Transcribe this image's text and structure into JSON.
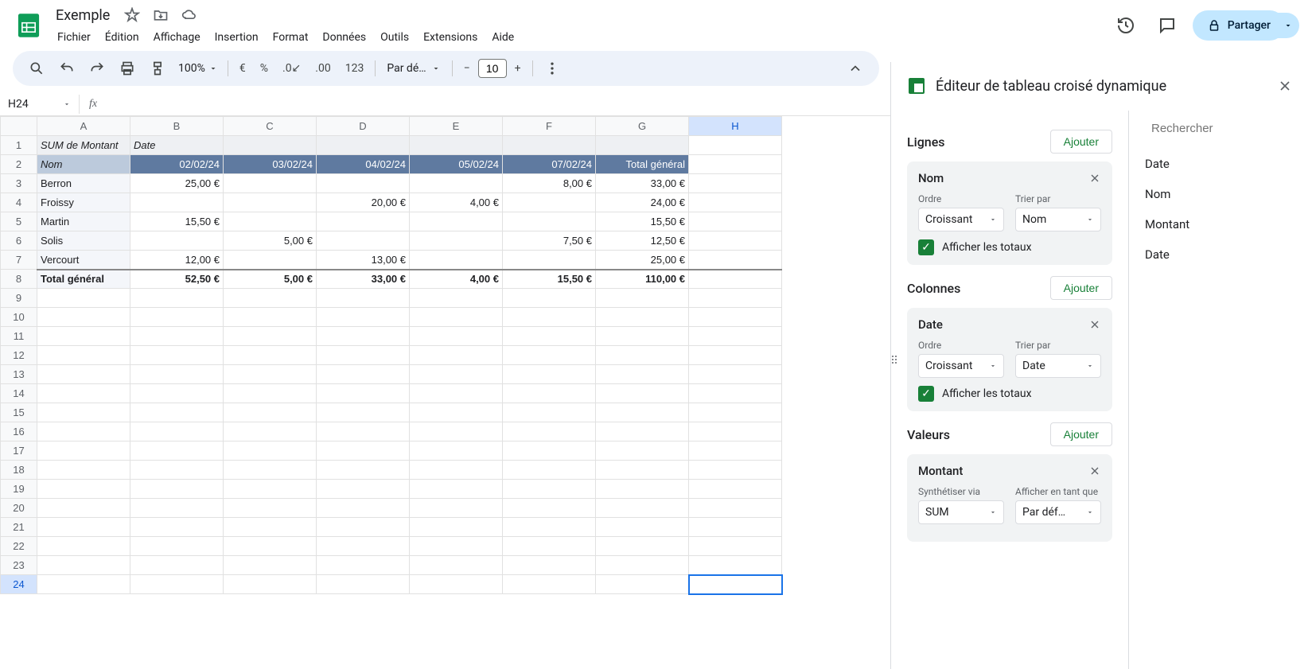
{
  "doc": {
    "title": "Exemple"
  },
  "menu": [
    "Fichier",
    "Édition",
    "Affichage",
    "Insertion",
    "Format",
    "Données",
    "Outils",
    "Extensions",
    "Aide"
  ],
  "share": {
    "label": "Partager"
  },
  "toolbar": {
    "zoom": "100%",
    "format123": "123",
    "font": "Par dé…",
    "fontsize": "10"
  },
  "namebox": "H24",
  "columns": [
    "A",
    "B",
    "C",
    "D",
    "E",
    "F",
    "G",
    "H"
  ],
  "pivot": {
    "h1a": "SUM de Montant",
    "h1b": "Date",
    "h2a": "Nom",
    "dates": [
      "02/02/24",
      "03/02/24",
      "04/02/24",
      "05/02/24",
      "07/02/24"
    ],
    "grand_col": "Total général",
    "rows": [
      {
        "name": "Berron",
        "v": [
          "25,00 €",
          "",
          "",
          "",
          "8,00 €"
        ],
        "t": "33,00 €"
      },
      {
        "name": "Froissy",
        "v": [
          "",
          "",
          "20,00 €",
          "4,00 €",
          ""
        ],
        "t": "24,00 €"
      },
      {
        "name": "Martin",
        "v": [
          "15,50 €",
          "",
          "",
          "",
          ""
        ],
        "t": "15,50 €"
      },
      {
        "name": "Solis",
        "v": [
          "",
          "5,00 €",
          "",
          "",
          "7,50 €"
        ],
        "t": "12,50 €"
      },
      {
        "name": "Vercourt",
        "v": [
          "12,00 €",
          "",
          "13,00 €",
          "",
          ""
        ],
        "t": "25,00 €"
      }
    ],
    "total_label": "Total général",
    "totals": [
      "52,50 €",
      "5,00 €",
      "33,00 €",
      "4,00 €",
      "15,50 €"
    ],
    "grand_total": "110,00 €"
  },
  "editor": {
    "title": "Éditeur de tableau croisé dynamique",
    "search_ph": "Rechercher",
    "fields": [
      "Date",
      "Nom",
      "Montant",
      "Date"
    ],
    "add": "Ajouter",
    "sections": {
      "rows": "Lignes",
      "cols": "Colonnes",
      "vals": "Valeurs"
    },
    "labels": {
      "order": "Ordre",
      "sortby": "Trier par",
      "showtotals": "Afficher les totaux",
      "summarize": "Synthétiser via",
      "showas": "Afficher en tant que"
    },
    "card_rows": {
      "title": "Nom",
      "order": "Croissant",
      "sort": "Nom"
    },
    "card_cols": {
      "title": "Date",
      "order": "Croissant",
      "sort": "Date"
    },
    "card_vals": {
      "title": "Montant",
      "sum": "SUM",
      "showas": "Par déf…"
    }
  }
}
